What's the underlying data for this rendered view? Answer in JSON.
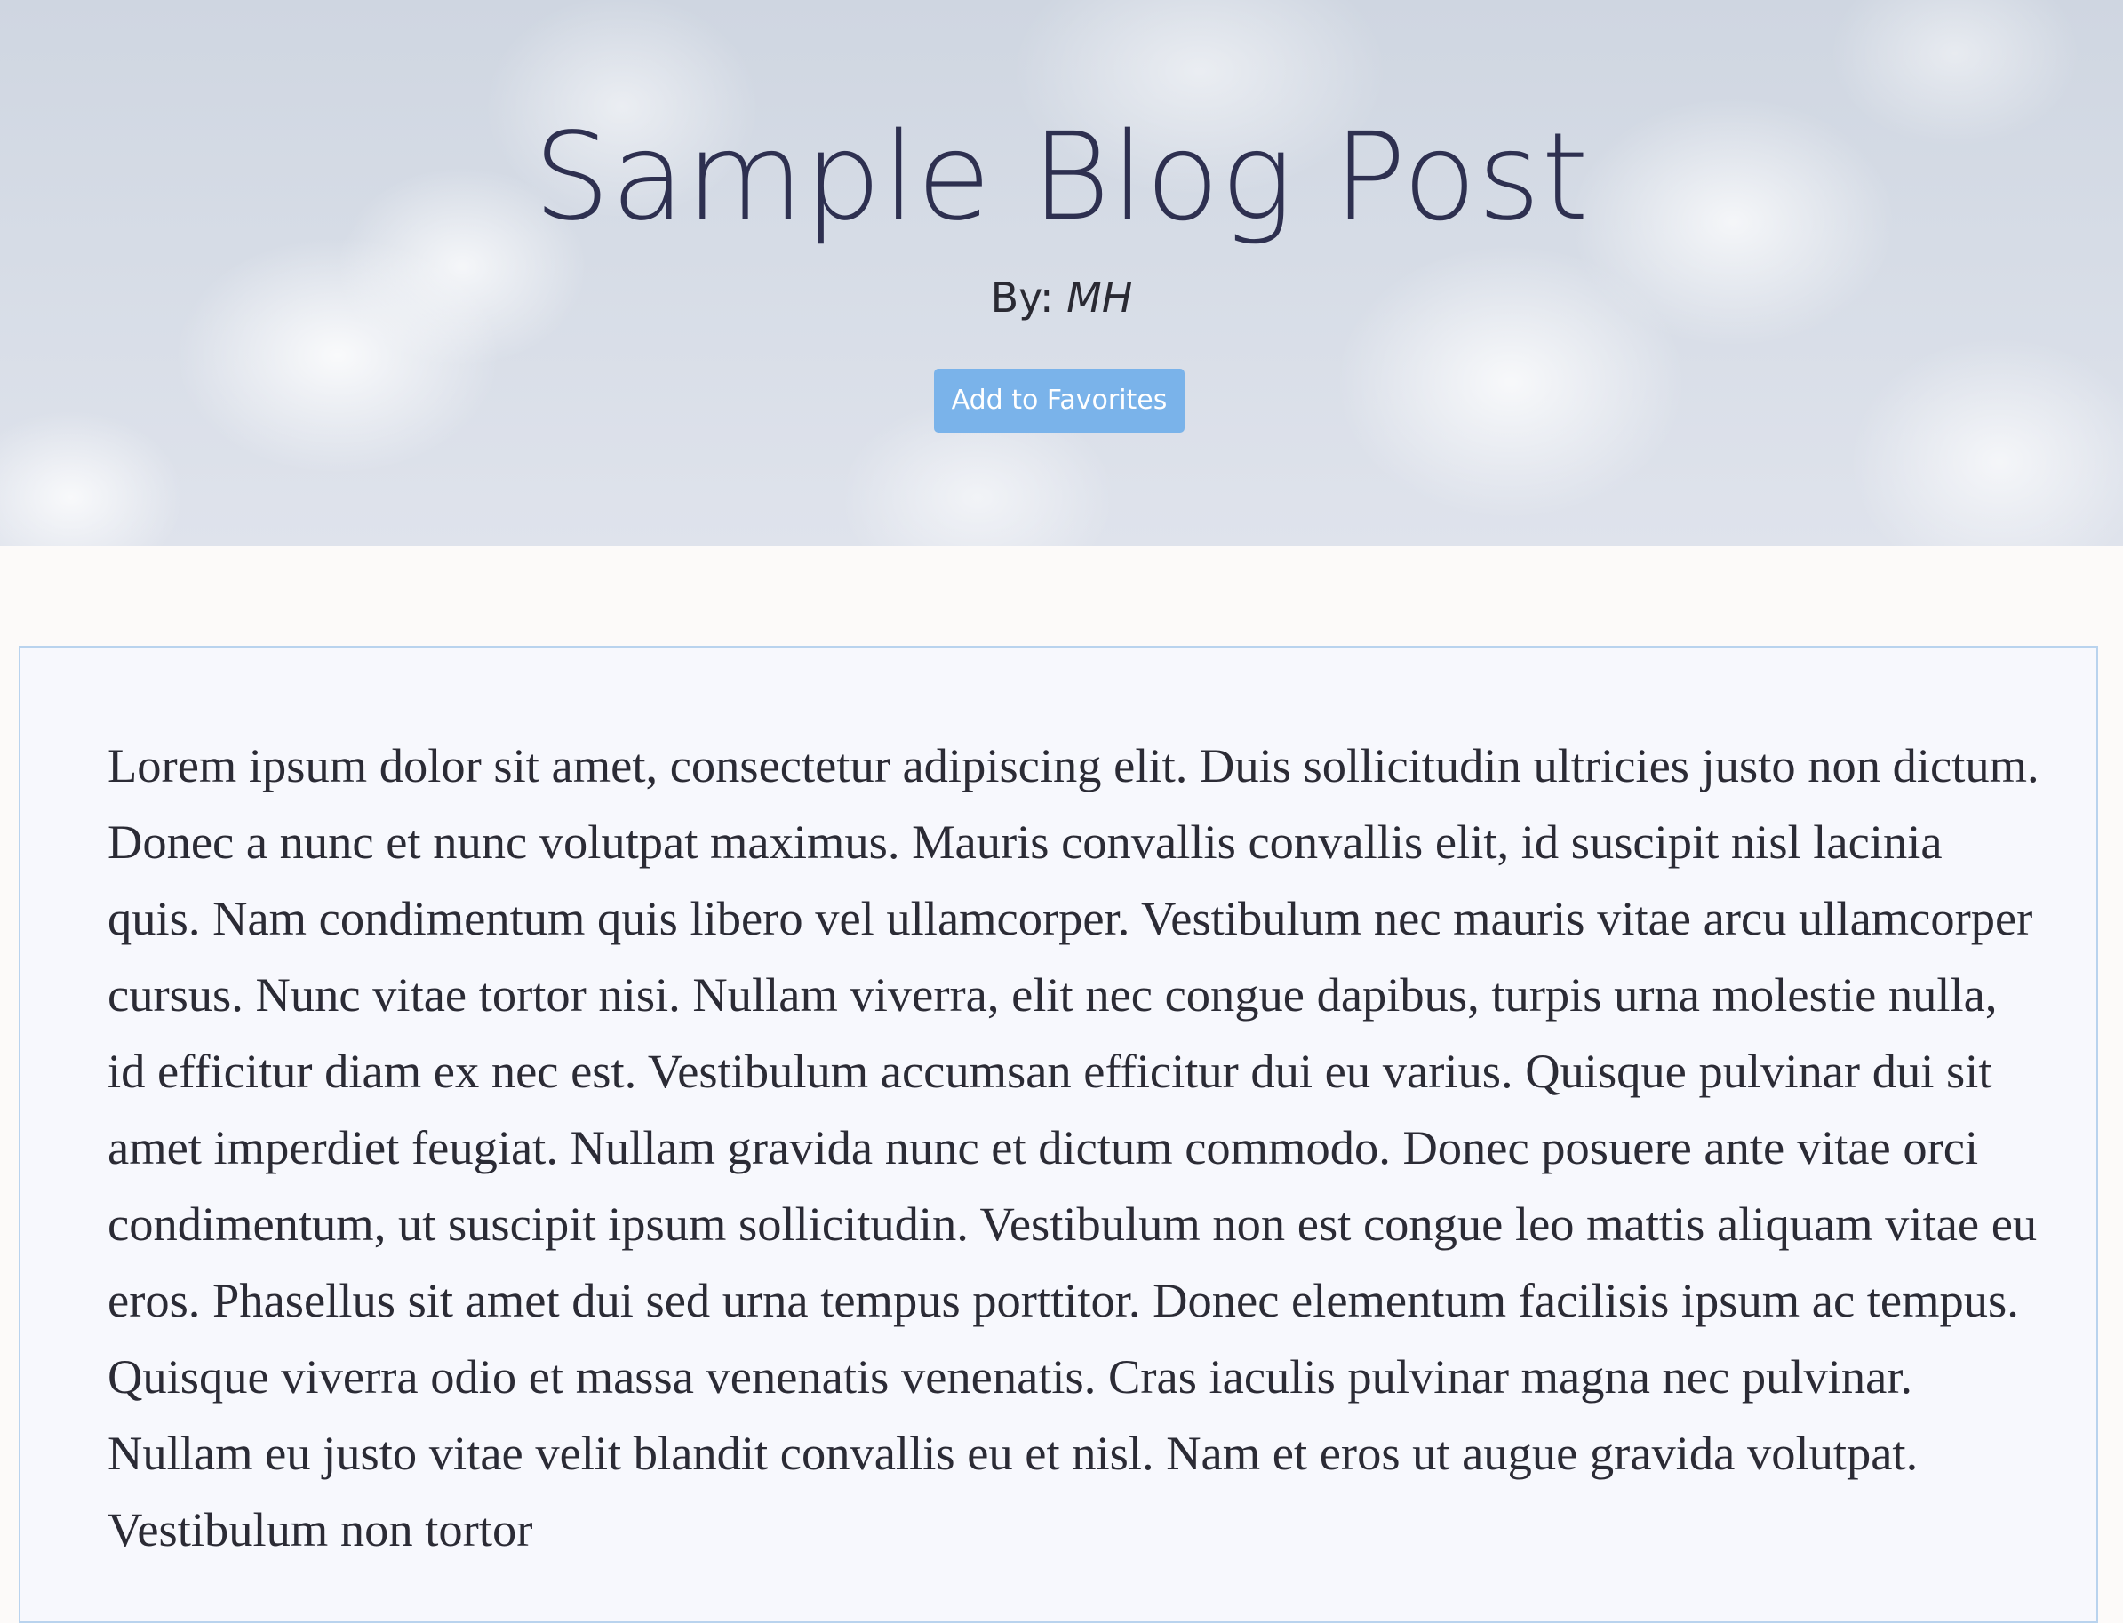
{
  "hero": {
    "title": "Sample Blog Post",
    "byline_prefix": "By:",
    "author": "MH",
    "favorite_button_label": "Add to Favorites",
    "accent_color": "#7ab3ea"
  },
  "post": {
    "body": "Lorem ipsum dolor sit amet, consectetur adipiscing elit. Duis sollicitudin ultricies justo non dictum. Donec a nunc et nunc volutpat maximus. Mauris convallis convallis elit, id suscipit nisl lacinia quis. Nam condimentum quis libero vel ullamcorper. Vestibulum nec mauris vitae arcu ullamcorper cursus. Nunc vitae tortor nisi. Nullam viverra, elit nec congue dapibus, turpis urna molestie nulla, id efficitur diam ex nec est. Vestibulum accumsan efficitur dui eu varius. Quisque pulvinar dui sit amet imperdiet feugiat. Nullam gravida nunc et dictum commodo. Donec posuere ante vitae orci condimentum, ut suscipit ipsum sollicitudin. Vestibulum non est congue leo mattis aliquam vitae eu eros. Phasellus sit amet dui sed urna tempus porttitor. Donec elementum facilisis ipsum ac tempus. Quisque viverra odio et massa venenatis venenatis. Cras iaculis pulvinar magna nec pulvinar. Nullam eu justo vitae velit blandit convallis eu et nisl. Nam et eros ut augue gravida volutpat. Vestibulum non tortor"
  }
}
